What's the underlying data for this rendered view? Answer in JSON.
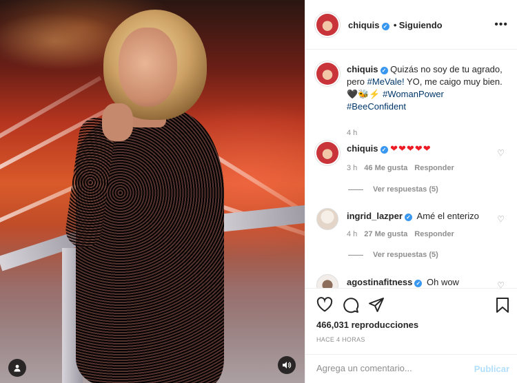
{
  "post": {
    "username": "chiquis",
    "follow_separator": "•",
    "follow_status": "Siguiendo",
    "more_icon": "more-horizontal-icon"
  },
  "caption": {
    "username": "chiquis",
    "text_before": "Quizás no soy de tu agrado, pero ",
    "tag1": "#MeVale!",
    "text_mid": " YO, me caigo muy bien. 🖤🐝⚡ ",
    "tag2": "#WomanPower",
    "tag3": "#BeeConfident",
    "time": "4 h"
  },
  "comments": [
    {
      "username": "chiquis",
      "text": "❤❤❤❤❤",
      "time": "3 h",
      "likes": "46 Me gusta",
      "reply": "Responder",
      "replies": "Ver respuestas (5)"
    },
    {
      "username": "ingrid_lazper",
      "text": "Amé el enterizo",
      "time": "4 h",
      "likes": "27 Me gusta",
      "reply": "Responder",
      "replies": "Ver respuestas (5)"
    },
    {
      "username": "agostinafitness",
      "text": "Oh wow"
    }
  ],
  "actions": {
    "views": "466,031 reproducciones",
    "ago": "HACE 4 HORAS"
  },
  "composer": {
    "placeholder": "Agrega un comentario...",
    "publish": "Publicar"
  },
  "colors": {
    "verified": "#3897f0",
    "hashtag": "#00376b",
    "publish_disabled": "#b2dffc",
    "secondary_text": "#8e8e8e"
  }
}
